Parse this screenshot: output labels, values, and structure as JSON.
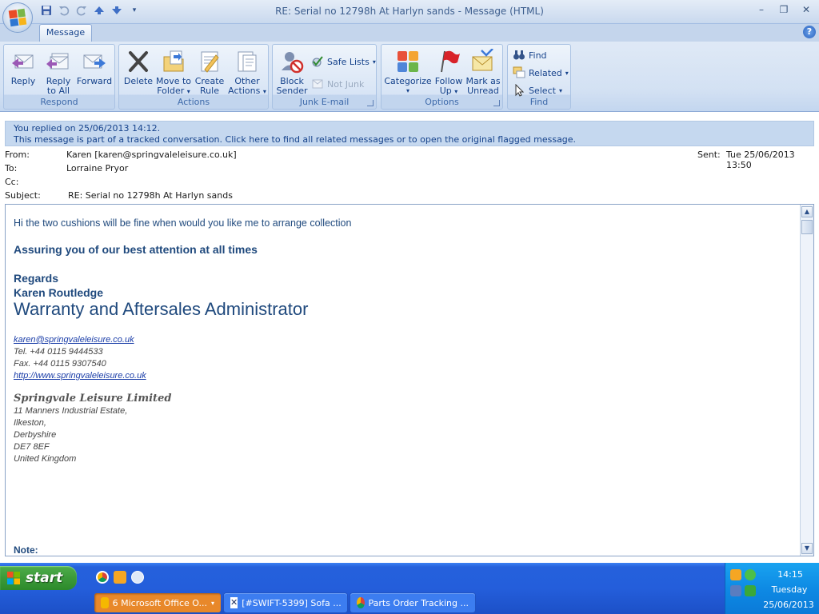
{
  "window": {
    "title": "RE: Serial no 12798h At Harlyn sands - Message (HTML)",
    "controls": [
      "minimize-icon",
      "restore-icon",
      "close-icon"
    ]
  },
  "ribbon": {
    "tab": "Message",
    "groups": {
      "respond": {
        "label": "Respond",
        "reply": "Reply",
        "reply_all_1": "Reply",
        "reply_all_2": "to All",
        "forward": "Forward"
      },
      "actions": {
        "label": "Actions",
        "delete": "Delete",
        "move_1": "Move to",
        "move_2": "Folder",
        "create_1": "Create",
        "create_2": "Rule",
        "other_1": "Other",
        "other_2": "Actions"
      },
      "junk": {
        "label": "Junk E-mail",
        "block_1": "Block",
        "block_2": "Sender",
        "safe_lists": "Safe Lists",
        "not_junk": "Not Junk"
      },
      "options": {
        "label": "Options",
        "categorize": "Categorize",
        "follow_1": "Follow",
        "follow_2": "Up",
        "mark_1": "Mark as",
        "mark_2": "Unread"
      },
      "find": {
        "label": "Find",
        "find": "Find",
        "related": "Related",
        "select": "Select"
      }
    }
  },
  "infobar": {
    "line1": "You replied on 25/06/2013 14:12.",
    "line2": "This message is part of a tracked conversation. Click here to find all related messages or to open the original flagged message."
  },
  "headers": {
    "from_label": "From:",
    "from_value": "Karen [karen@springvaleleisure.co.uk]",
    "to_label": "To:",
    "to_value": "Lorraine Pryor",
    "cc_label": "Cc:",
    "cc_value": "",
    "subject_label": "Subject:",
    "subject_value": "RE: Serial no 12798h At Harlyn sands",
    "sent_label": "Sent:",
    "sent_value": "Tue 25/06/2013 13:50"
  },
  "message": {
    "line1": "Hi the two cushions will be fine when would you like me to arrange collection",
    "assurance": "Assuring you of our best attention at all times",
    "regards": "Regards",
    "name": "Karen Routledge",
    "job_title": "Warranty and Aftersales Administrator",
    "email_link": "karen@springvaleleisure.co.uk",
    "tel": "Tel.  +44 0115 9444533",
    "fax": "Fax. +44 0115 9307540",
    "web_link": "http://www.springvaleleisure.co.uk",
    "company": "Springvale Leisure Limited",
    "address": [
      "11 Manners Industrial Estate,",
      "Ilkeston,",
      "Derbyshire",
      "DE7 8EF",
      "United Kingdom"
    ],
    "note": "Note:"
  },
  "taskbar": {
    "start": "start",
    "tasks": [
      {
        "label": "6 Microsoft Office O...",
        "active": true
      },
      {
        "label": "[#SWIFT-5399] Sofa ...",
        "active": false
      },
      {
        "label": "Parts Order Tracking ...",
        "active": false
      }
    ],
    "clock": {
      "time": "14:15",
      "day": "Tuesday",
      "date": "25/06/2013"
    }
  },
  "colors": {
    "ribbon_bg": "#d3e1f3",
    "taskbar_blue": "#245edb",
    "start_green": "#3c9a39",
    "active_task": "#e8882a",
    "body_text": "#1f497d"
  }
}
